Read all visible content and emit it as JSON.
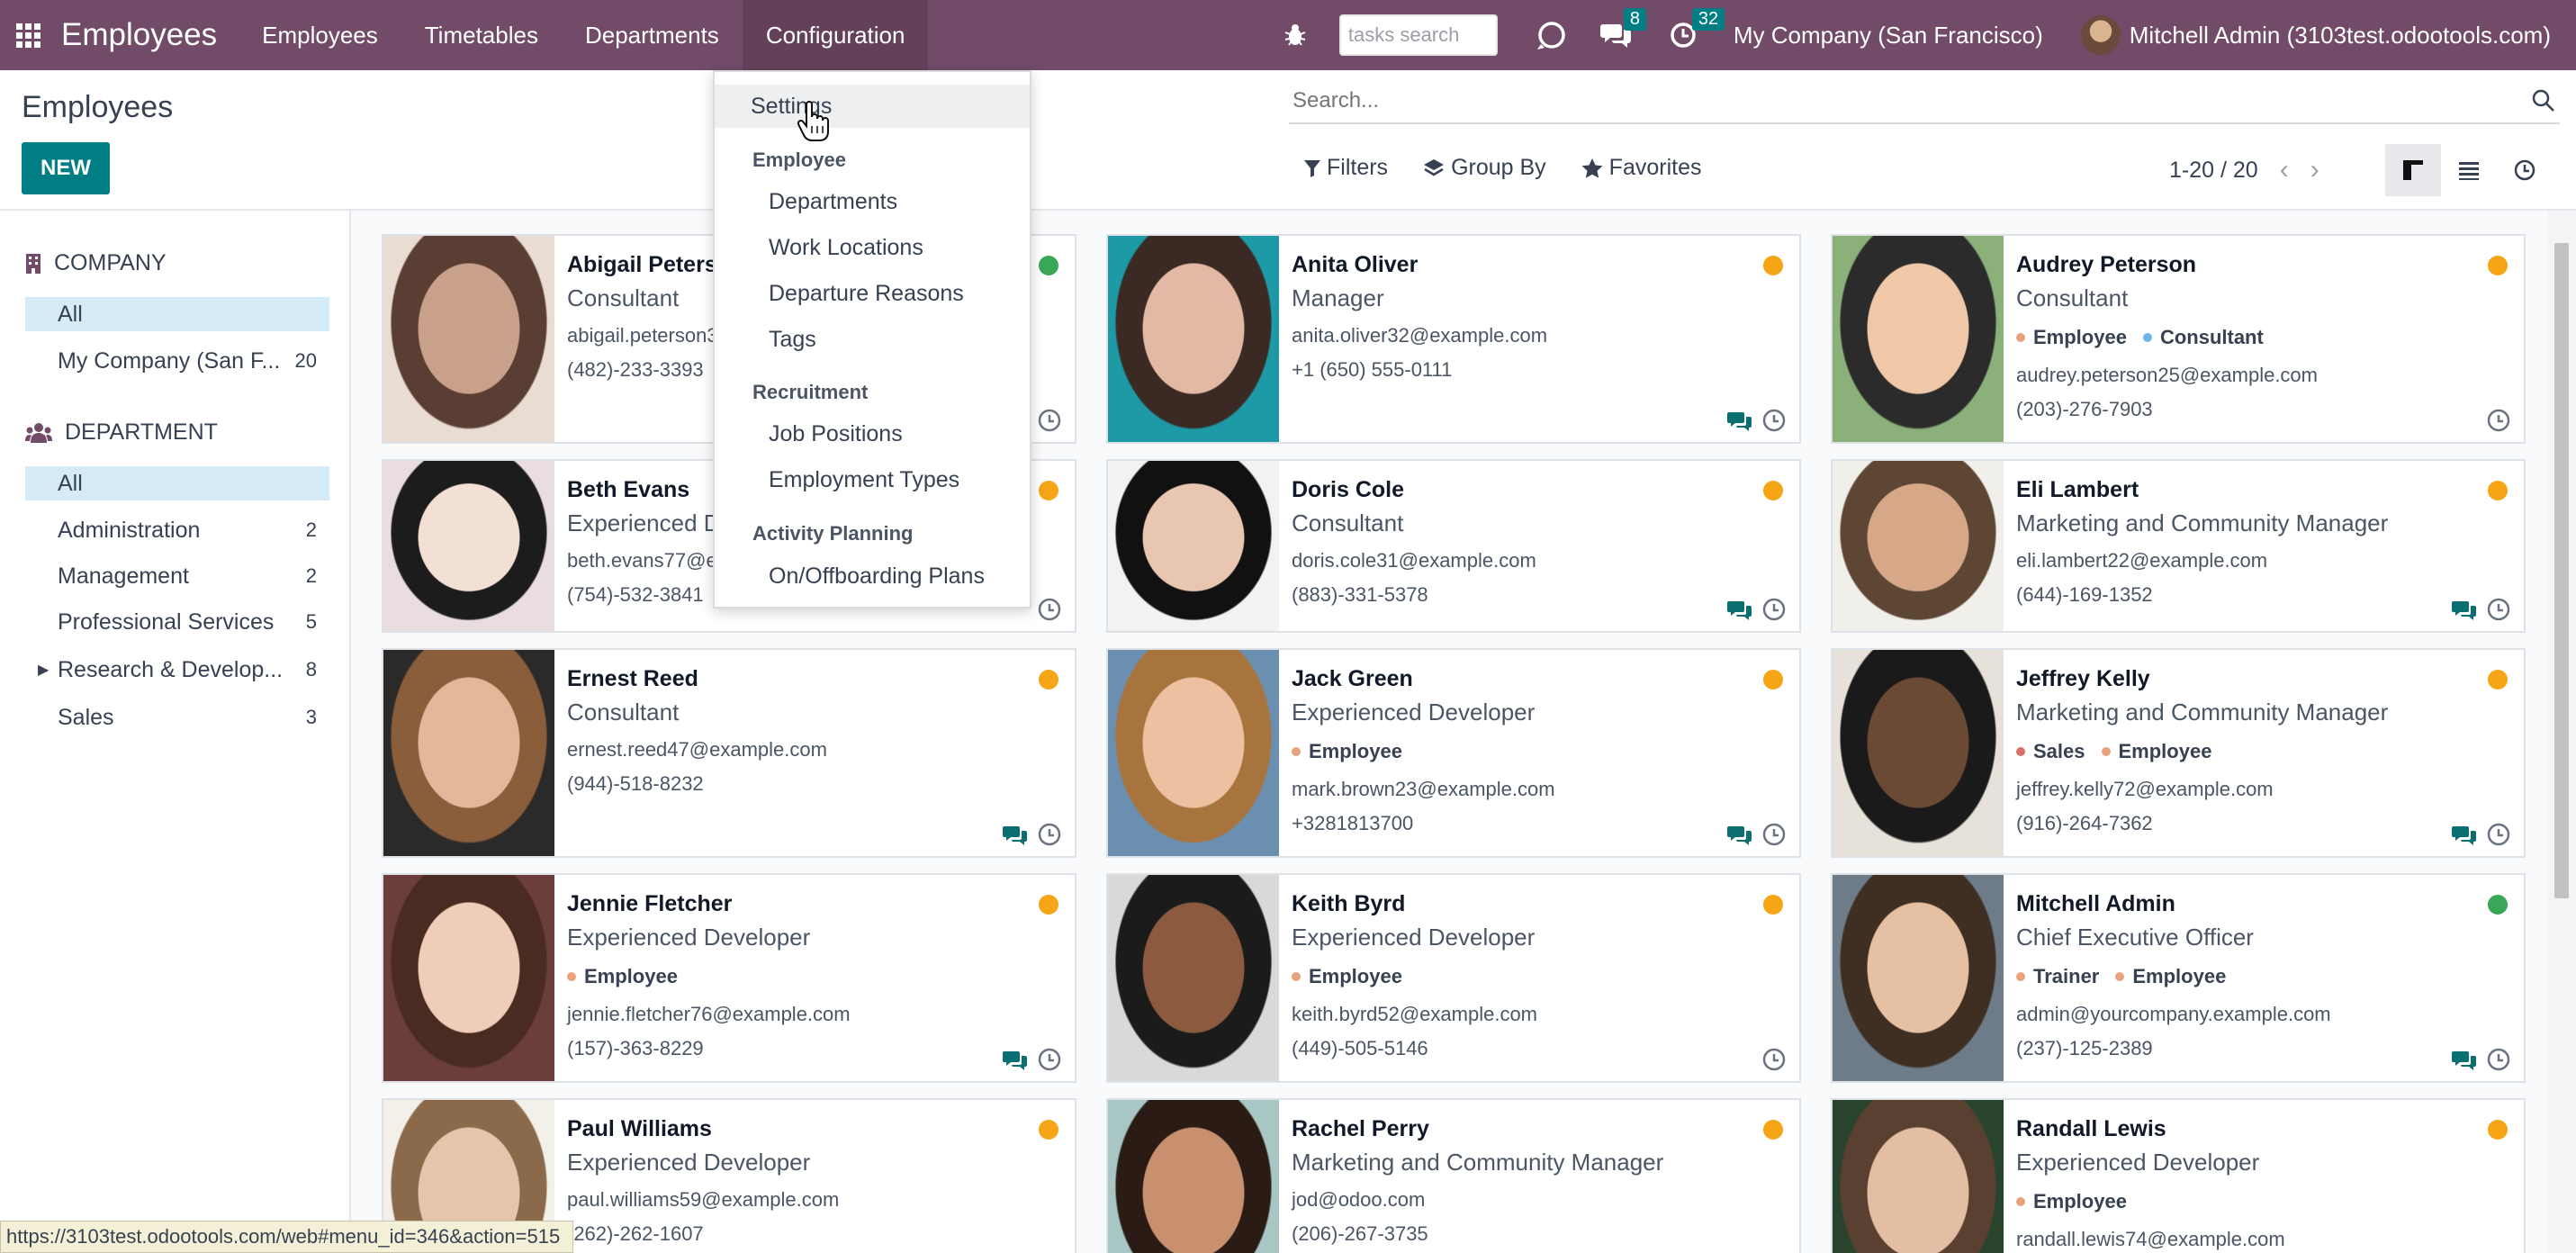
{
  "navbar": {
    "brand": "Employees",
    "menus": [
      "Employees",
      "Timetables",
      "Departments",
      "Configuration"
    ],
    "task_search_placeholder": "tasks search",
    "messages_badge": "8",
    "activities_badge": "32",
    "company": "My Company (San Francisco)",
    "user": "Mitchell Admin (3103test.odootools.com)"
  },
  "control_panel": {
    "title": "Employees",
    "new_label": "NEW",
    "search_placeholder": "Search...",
    "filters_label": "Filters",
    "groupby_label": "Group By",
    "favorites_label": "Favorites",
    "pager": "1-20 / 20"
  },
  "config_menu": {
    "settings": "Settings",
    "sections": [
      {
        "header": "Employee",
        "items": [
          "Departments",
          "Work Locations",
          "Departure Reasons",
          "Tags"
        ]
      },
      {
        "header": "Recruitment",
        "items": [
          "Job Positions",
          "Employment Types"
        ]
      },
      {
        "header": "Activity Planning",
        "items": [
          "On/Offboarding Plans"
        ]
      }
    ]
  },
  "sidebar": {
    "company_header": "COMPANY",
    "company_items": [
      {
        "label": "All",
        "count": ""
      },
      {
        "label": "My Company (San F...",
        "count": "20"
      }
    ],
    "department_header": "DEPARTMENT",
    "department_items": [
      {
        "label": "All",
        "count": ""
      },
      {
        "label": "Administration",
        "count": "2"
      },
      {
        "label": "Management",
        "count": "2"
      },
      {
        "label": "Professional Services",
        "count": "5"
      },
      {
        "label": "Research & Develop...",
        "count": "8"
      },
      {
        "label": "Sales",
        "count": "3"
      }
    ]
  },
  "employees": [
    {
      "name": "Abigail Peterson",
      "job": "Consultant",
      "tags": [],
      "email": "abigail.peterson39@example.com",
      "phone": "(482)-233-3393",
      "status": "online",
      "chat": false
    },
    {
      "name": "Anita Oliver",
      "job": "Manager",
      "tags": [],
      "email": "anita.oliver32@example.com",
      "phone": "+1 (650) 555-0111",
      "status": "away",
      "chat": true
    },
    {
      "name": "Audrey Peterson",
      "job": "Consultant",
      "tags": [
        "Employee",
        "Consultant"
      ],
      "email": "audrey.peterson25@example.com",
      "phone": "(203)-276-7903",
      "status": "away",
      "chat": false
    },
    {
      "name": "Beth Evans",
      "job": "Experienced Developer",
      "tags": [],
      "email": "beth.evans77@example.com",
      "phone": "(754)-532-3841",
      "status": "away",
      "chat": false
    },
    {
      "name": "Doris Cole",
      "job": "Consultant",
      "tags": [],
      "email": "doris.cole31@example.com",
      "phone": "(883)-331-5378",
      "status": "away",
      "chat": true
    },
    {
      "name": "Eli Lambert",
      "job": "Marketing and Community Manager",
      "tags": [],
      "email": "eli.lambert22@example.com",
      "phone": "(644)-169-1352",
      "status": "away",
      "chat": true
    },
    {
      "name": "Ernest Reed",
      "job": "Consultant",
      "tags": [],
      "email": "ernest.reed47@example.com",
      "phone": "(944)-518-8232",
      "status": "away",
      "chat": true
    },
    {
      "name": "Jack Green",
      "job": "Experienced Developer",
      "tags": [
        "Employee"
      ],
      "email": "mark.brown23@example.com",
      "phone": "+3281813700",
      "status": "away",
      "chat": true
    },
    {
      "name": "Jeffrey Kelly",
      "job": "Marketing and Community Manager",
      "tags": [
        "Sales",
        "Employee"
      ],
      "email": "jeffrey.kelly72@example.com",
      "phone": "(916)-264-7362",
      "status": "away",
      "chat": true
    },
    {
      "name": "Jennie Fletcher",
      "job": "Experienced Developer",
      "tags": [
        "Employee"
      ],
      "email": "jennie.fletcher76@example.com",
      "phone": "(157)-363-8229",
      "status": "away",
      "chat": true
    },
    {
      "name": "Keith Byrd",
      "job": "Experienced Developer",
      "tags": [
        "Employee"
      ],
      "email": "keith.byrd52@example.com",
      "phone": "(449)-505-5146",
      "status": "away",
      "chat": false
    },
    {
      "name": "Mitchell Admin",
      "job": "Chief Executive Officer",
      "tags": [
        "Trainer",
        "Employee"
      ],
      "email": "admin@yourcompany.example.com",
      "phone": "(237)-125-2389",
      "status": "online",
      "chat": true
    },
    {
      "name": "Paul Williams",
      "job": "Experienced Developer",
      "tags": [],
      "email": "paul.williams59@example.com",
      "phone": "(262)-262-1607",
      "status": "away",
      "chat": false
    },
    {
      "name": "Rachel Perry",
      "job": "Marketing and Community Manager",
      "tags": [],
      "email": "jod@odoo.com",
      "phone": "(206)-267-3735",
      "status": "away",
      "chat": false
    },
    {
      "name": "Randall Lewis",
      "job": "Experienced Developer",
      "tags": [
        "Employee"
      ],
      "email": "randall.lewis74@example.com",
      "phone": "",
      "status": "away",
      "chat": false
    }
  ],
  "tag_colors": {
    "Employee": "#e8a27c",
    "Consultant": "#6cb6e8",
    "Sales": "#d9706a",
    "Trainer": "#e8a27c"
  },
  "status_colors": {
    "online": "#3aa657",
    "away": "#f5a516"
  },
  "status_url": "https://3103test.odootools.com/web#menu_id=346&action=515"
}
